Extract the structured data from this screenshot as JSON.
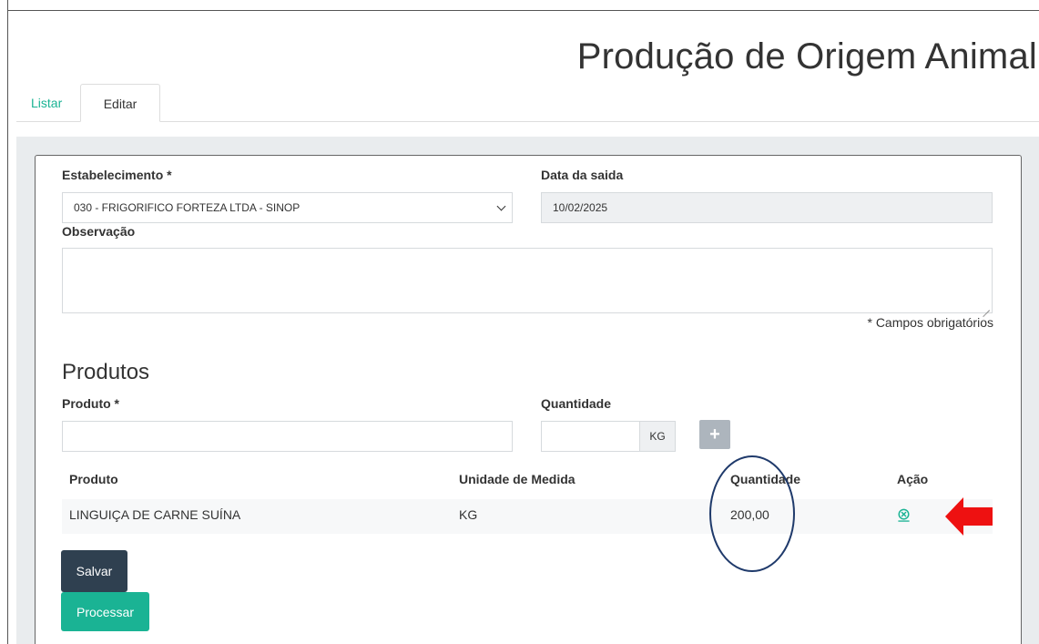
{
  "page_title": "Produção de Origem Animal",
  "tabs": [
    {
      "label": "Listar"
    },
    {
      "label": "Editar"
    }
  ],
  "form": {
    "estabelecimento_label": "Estabelecimento *",
    "estabelecimento_value": "030 - FRIGORIFICO FORTEZA LTDA - SINOP",
    "data_saida_label": "Data da saida",
    "data_saida_value": "10/02/2025",
    "observacao_label": "Observação",
    "observacao_value": "",
    "required_note": "* Campos obrigatórios"
  },
  "produtos": {
    "section_title": "Produtos",
    "produto_label": "Produto *",
    "produto_value": "",
    "quantidade_label": "Quantidade",
    "quantidade_value": "",
    "unit_addon": "KG",
    "add_button": "+",
    "table": {
      "headers": [
        "Produto",
        "Unidade de Medida",
        "Quantidade",
        "Ação"
      ],
      "rows": [
        {
          "produto": "LINGUIÇA DE CARNE SUÍNA",
          "unidade": "KG",
          "quantidade": "200,00",
          "action_icon": "remove-circle-icon"
        }
      ]
    }
  },
  "buttons": {
    "save": "Salvar",
    "process": "Processar"
  },
  "colors": {
    "accent": "#1ab394",
    "dark_button": "#2f4050",
    "annotation_circle": "#1f3a6b",
    "annotation_arrow": "#ee1111"
  }
}
